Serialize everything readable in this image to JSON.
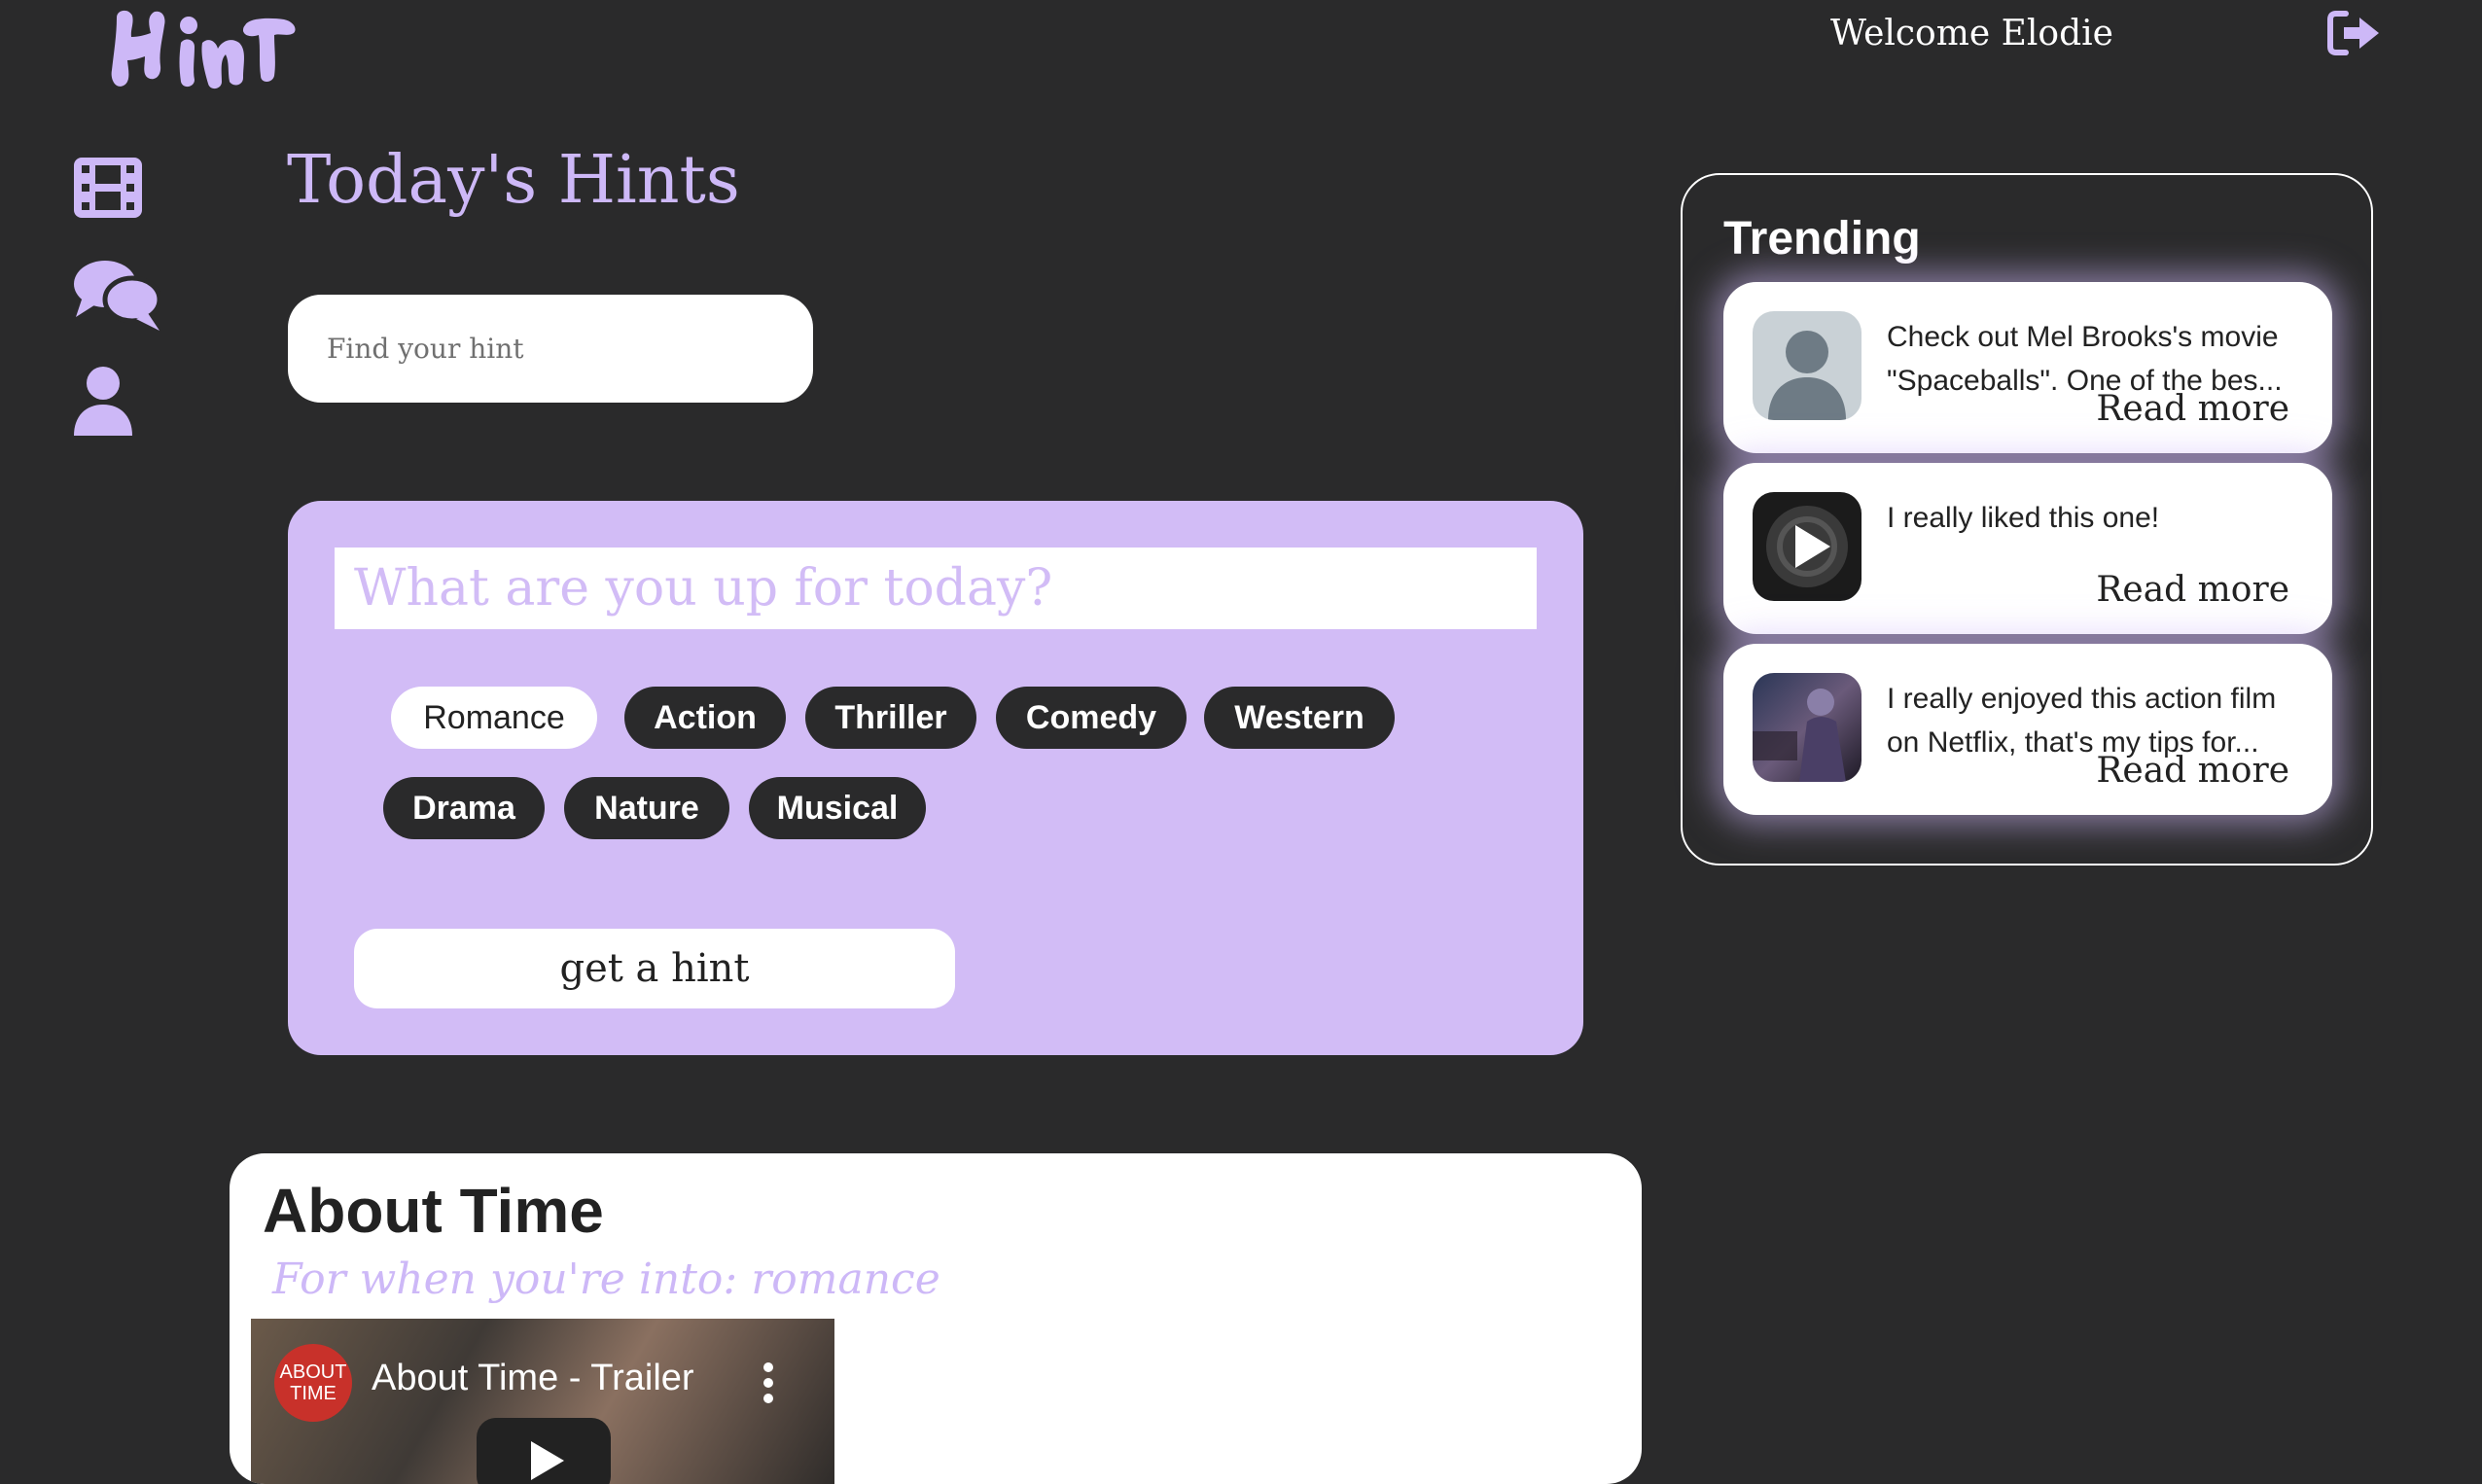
{
  "header": {
    "logo_text": "Hint",
    "welcome": "Welcome Elodie"
  },
  "sidebar": {
    "items": [
      "film-icon",
      "chat-icon",
      "user-icon"
    ]
  },
  "main": {
    "title": "Today's Hints",
    "search_placeholder": "Find your hint",
    "mood_placeholder": "What are you up for today?",
    "genres": [
      "Romance",
      "Action",
      "Thriller",
      "Comedy",
      "Western",
      "Drama",
      "Nature",
      "Musical"
    ],
    "selected_genre": "Romance",
    "get_hint": "get a hint"
  },
  "result": {
    "title": "About Time",
    "subtitle": "For when you're into: romance",
    "video_channel": "ABOUT TIME",
    "video_title": "About Time - Trailer"
  },
  "trending": {
    "title": "Trending",
    "items": [
      {
        "text": "Check out Mel Brooks's movie \"Spaceballs\". One of the bes...",
        "read_more": "Read more",
        "thumb": "avatar-placeholder"
      },
      {
        "text": "I really liked this one!",
        "read_more": "Read more",
        "thumb": "video-play"
      },
      {
        "text": "I really enjoyed this action film on Netflix, that's my tips for...",
        "read_more": "Read more",
        "thumb": "movie-poster"
      }
    ]
  },
  "colors": {
    "background": "#2a2a2b",
    "accent": "#cdb8f7",
    "panel": "#d2bcf6"
  }
}
